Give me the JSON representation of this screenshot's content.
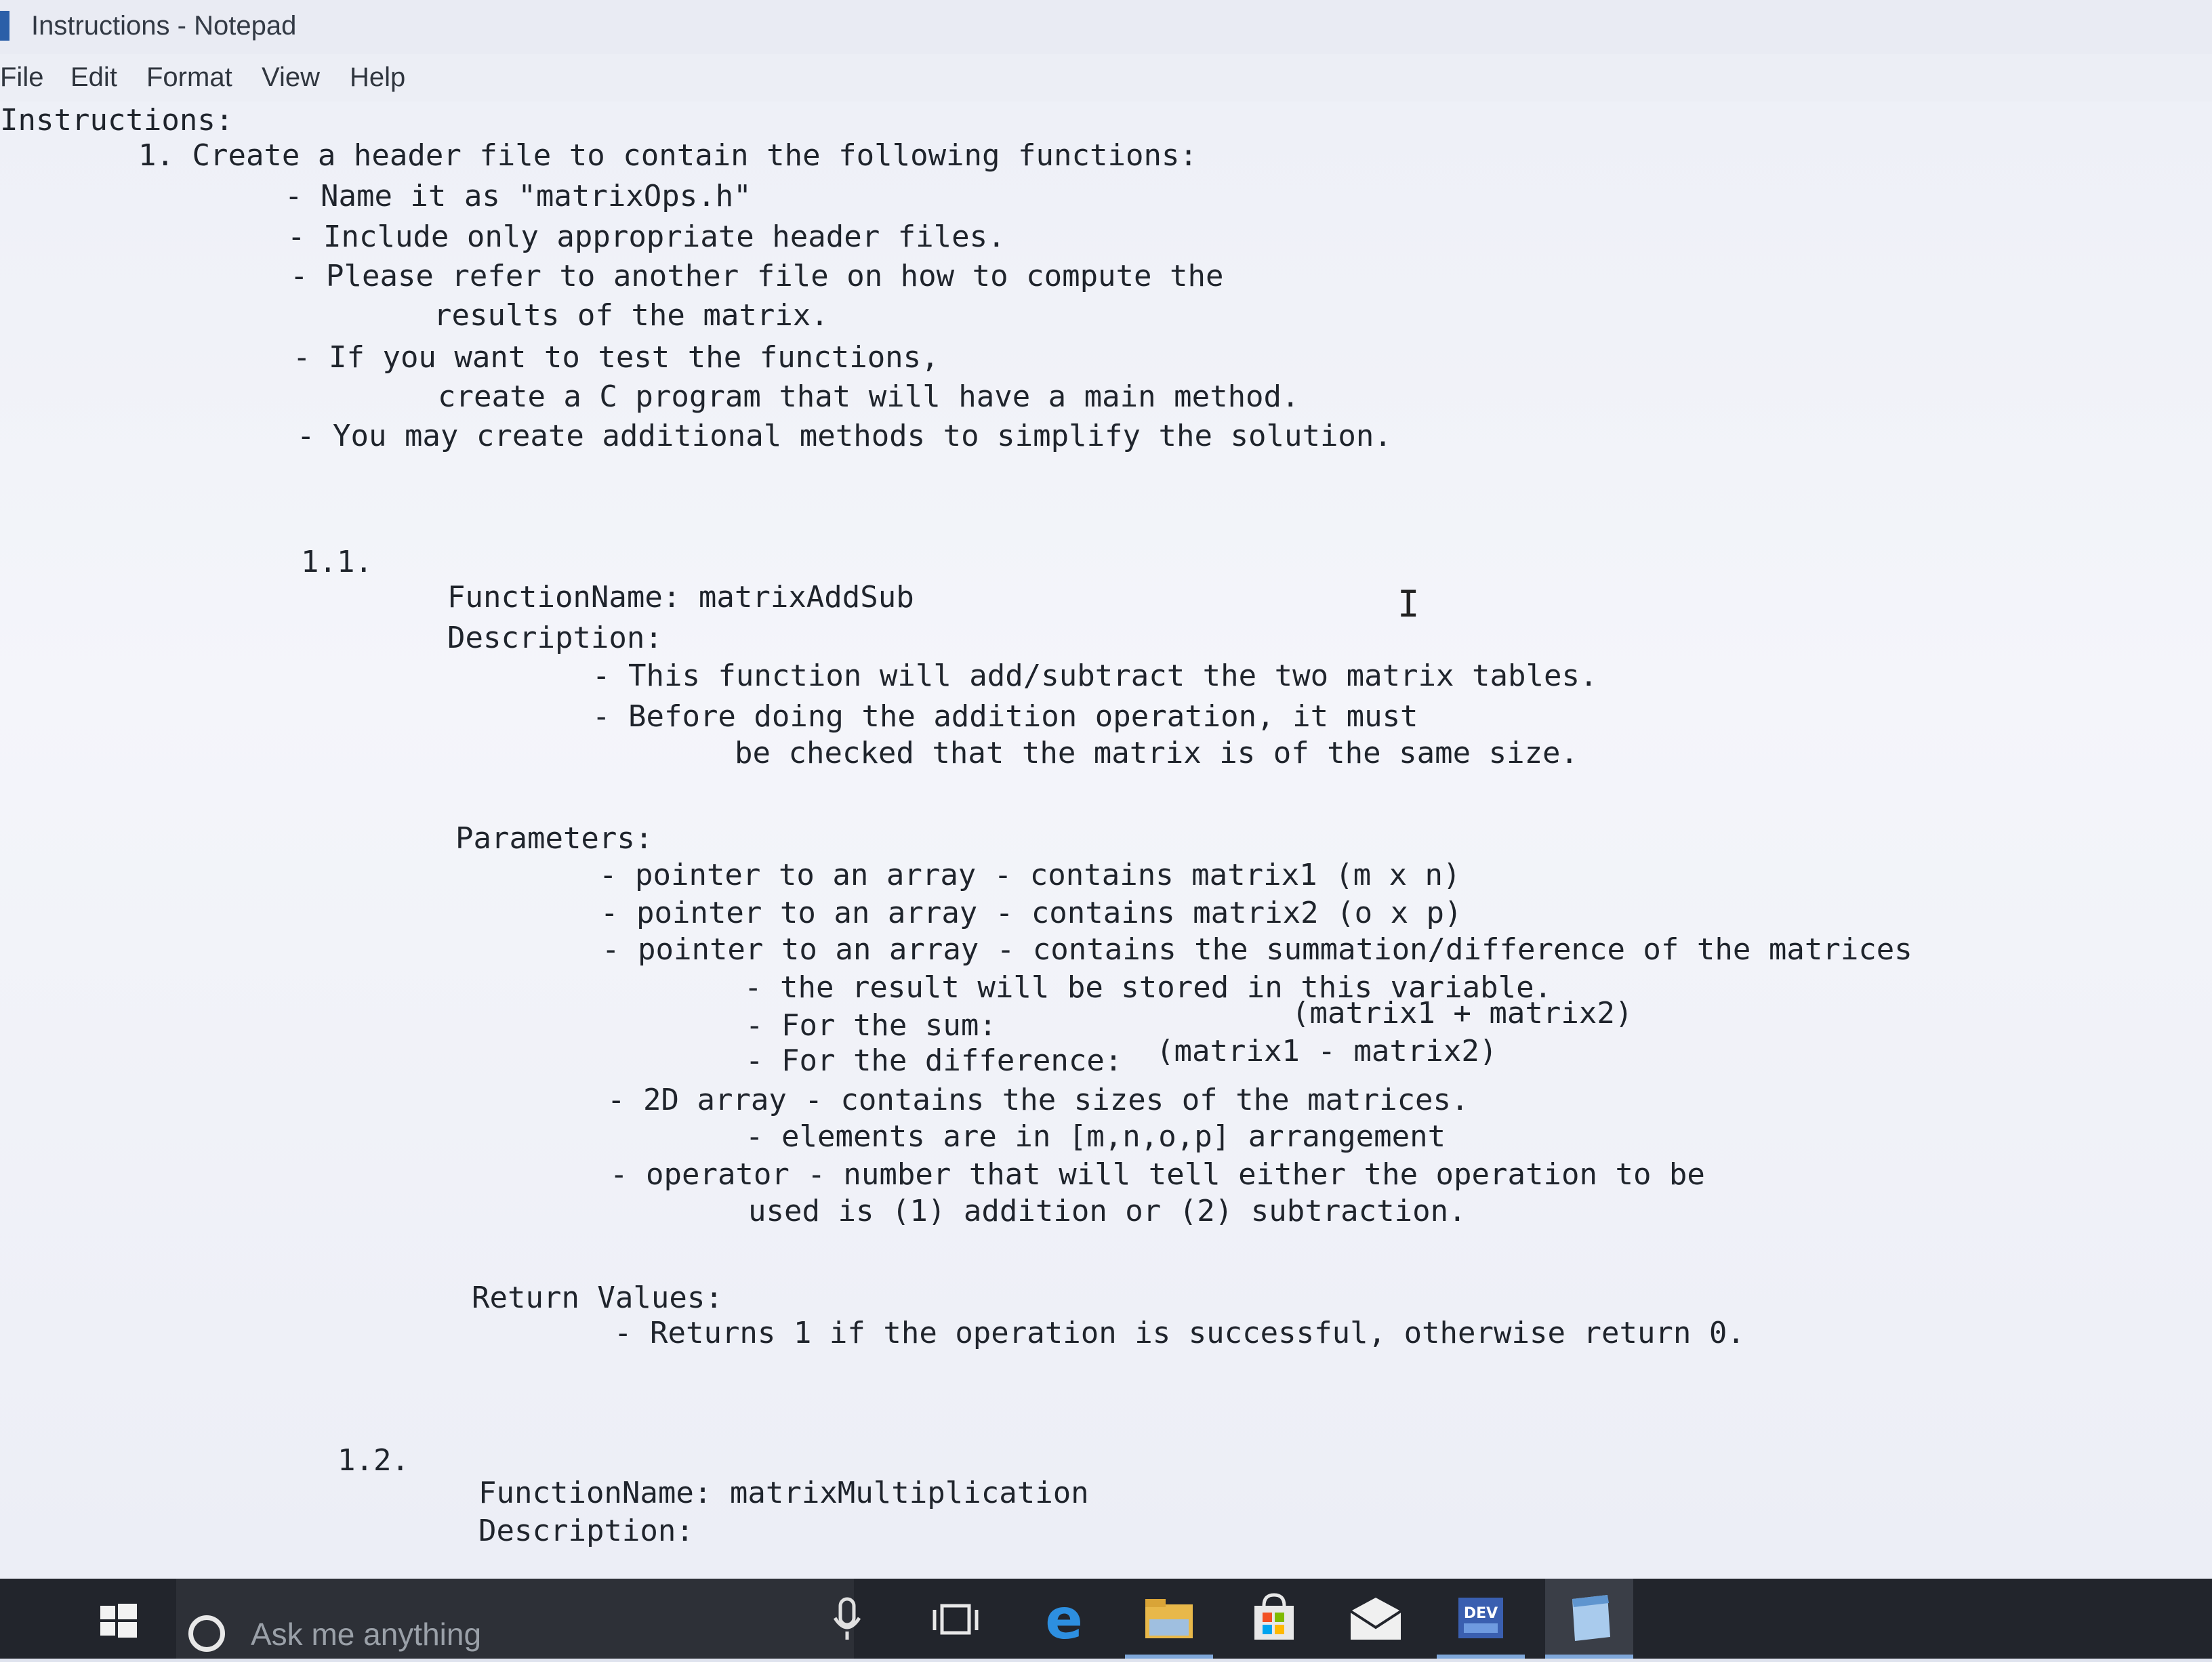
{
  "window": {
    "title": "Instructions - Notepad"
  },
  "menu": {
    "file": "File",
    "edit": "Edit",
    "format": "Format",
    "view": "View",
    "help": "Help"
  },
  "lines": [
    "Instructions:",
    "1. Create a header file to contain the following functions:",
    "- Name it as \"matrixOps.h\"",
    "- Include only appropriate header files.",
    "- Please refer to another file on how to compute the",
    "results of the matrix.",
    "- If you want to test the functions,",
    "create a C program that will have a main method.",
    "- You may create additional methods to simplify the solution.",
    "1.1.",
    "FunctionName: matrixAddSub",
    "Description:",
    "- This function will add/subtract the two matrix tables.",
    "- Before doing the addition operation, it must",
    "be checked that the matrix is of the same size.",
    "Parameters:",
    "- pointer to an array - contains matrix1 (m x n)",
    "- pointer to an array - contains matrix2 (o x p)",
    "- pointer to an array - contains the summation/difference of the matrices",
    "- the result will be stored in this variable.",
    "- For the sum:",
    "(matrix1 + matrix2)",
    "- For the difference:",
    "(matrix1 - matrix2)",
    "- 2D array - contains the sizes of the matrices.",
    "- elements are in [m,n,o,p] arrangement",
    "- operator - number that will tell either the operation to be",
    "used is (1) addition or (2) subtraction.",
    "Return Values:",
    "- Returns 1 if the operation is successful, otherwise return 0.",
    "1.2.",
    "FunctionName: matrixMultiplication",
    "Description:"
  ],
  "taskbar": {
    "search_placeholder": "Ask me anything",
    "icons": [
      "windows-start-icon",
      "cortana-icon",
      "microphone-icon",
      "task-view-icon",
      "edge-icon",
      "file-explorer-icon",
      "store-icon",
      "mail-icon",
      "dev-cpp-icon",
      "notepad-icon"
    ],
    "dev_label": "DEV"
  }
}
